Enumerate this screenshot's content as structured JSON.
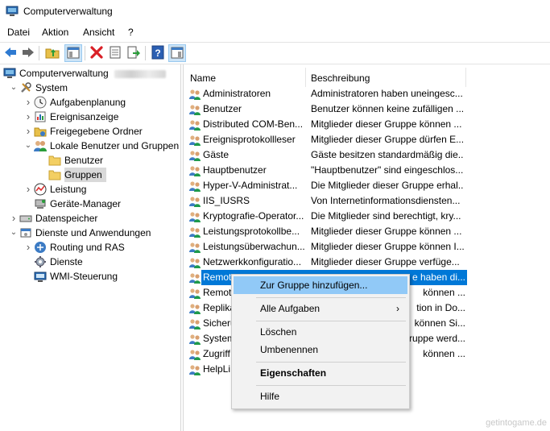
{
  "window": {
    "title": "Computerverwaltung"
  },
  "menu": [
    "Datei",
    "Aktion",
    "Ansicht",
    "?"
  ],
  "toolbar": {
    "buttons": [
      "back-icon",
      "forward-icon",
      "up-folder-icon",
      "show-hide-tree-icon",
      "delete-icon",
      "properties-icon",
      "export-icon",
      "help-icon",
      "view-icon"
    ]
  },
  "tree": [
    {
      "label": "Computerverwaltung",
      "icon": "computer-icon",
      "expander": "none",
      "level": 0
    },
    {
      "label": "System",
      "icon": "tools-icon",
      "expander": "expanded",
      "level": 1
    },
    {
      "label": "Aufgabenplanung",
      "icon": "clock-icon",
      "expander": "collapsed",
      "level": 2
    },
    {
      "label": "Ereignisanzeige",
      "icon": "event-viewer-icon",
      "expander": "collapsed",
      "level": 2
    },
    {
      "label": "Freigegebene Ordner",
      "icon": "shared-folder-icon",
      "expander": "collapsed",
      "level": 2
    },
    {
      "label": "Lokale Benutzer und Gruppen",
      "icon": "users-icon",
      "expander": "expanded",
      "level": 2
    },
    {
      "label": "Benutzer",
      "icon": "folder-icon",
      "expander": "none",
      "level": 3
    },
    {
      "label": "Gruppen",
      "icon": "folder-icon",
      "expander": "none",
      "level": 3,
      "selected": true
    },
    {
      "label": "Leistung",
      "icon": "performance-icon",
      "expander": "collapsed",
      "level": 2
    },
    {
      "label": "Geräte-Manager",
      "icon": "device-manager-icon",
      "expander": "none",
      "level": 2
    },
    {
      "label": "Datenspeicher",
      "icon": "storage-icon",
      "expander": "collapsed",
      "level": 1
    },
    {
      "label": "Dienste und Anwendungen",
      "icon": "services-apps-icon",
      "expander": "expanded",
      "level": 1
    },
    {
      "label": "Routing und RAS",
      "icon": "routing-icon",
      "expander": "collapsed",
      "level": 2
    },
    {
      "label": "Dienste",
      "icon": "gear-icon",
      "expander": "none",
      "level": 2
    },
    {
      "label": "WMI-Steuerung",
      "icon": "wmi-icon",
      "expander": "none",
      "level": 2
    }
  ],
  "list": {
    "columns": [
      "Name",
      "Beschreibung"
    ],
    "rows": [
      {
        "name": "Administratoren",
        "desc": "Administratoren haben uneingesc..."
      },
      {
        "name": "Benutzer",
        "desc": "Benutzer können keine zufälligen ..."
      },
      {
        "name": "Distributed COM-Ben...",
        "desc": "Mitglieder dieser Gruppe können ..."
      },
      {
        "name": "Ereignisprotokollleser",
        "desc": "Mitglieder dieser Gruppe dürfen E..."
      },
      {
        "name": "Gäste",
        "desc": "Gäste besitzen standardmäßig die..."
      },
      {
        "name": "Hauptbenutzer",
        "desc": "\"Hauptbenutzer\" sind eingeschlos..."
      },
      {
        "name": "Hyper-V-Administrat...",
        "desc": "Die Mitglieder dieser Gruppe erhal..."
      },
      {
        "name": "IIS_IUSRS",
        "desc": "Von Internetinformationsdiensten..."
      },
      {
        "name": "Kryptografie-Operator...",
        "desc": "Die Mitglieder sind berechtigt, kry..."
      },
      {
        "name": "Leistungsprotokollbe...",
        "desc": "Mitglieder dieser Gruppe können ..."
      },
      {
        "name": "Leistungsüberwachun...",
        "desc": "Mitglieder dieser Gruppe können I..."
      },
      {
        "name": "Netzwerkkonfiguratio...",
        "desc": "Mitglieder dieser Gruppe verfüge..."
      },
      {
        "name": "Remot",
        "desc": "e haben di...",
        "selected": true
      },
      {
        "name": "Remot",
        "desc": "können ..."
      },
      {
        "name": "Replika",
        "desc": "tion in Do..."
      },
      {
        "name": "Sicheru",
        "desc": "können Si..."
      },
      {
        "name": "System",
        "desc": "Gruppe werd..."
      },
      {
        "name": "Zugriff",
        "desc": "können ..."
      },
      {
        "name": "HelpLi",
        "desc": ""
      }
    ]
  },
  "context_menu": [
    {
      "label": "Zur Gruppe hinzufügen...",
      "hover": true
    },
    {
      "label": "Alle Aufgaben",
      "submenu": true
    },
    {
      "label": "Löschen"
    },
    {
      "label": "Umbenennen"
    },
    {
      "label": "Eigenschaften",
      "bold": true
    },
    {
      "label": "Hilfe"
    }
  ],
  "submenu_arrow": "›",
  "watermark": "getintogame.de"
}
